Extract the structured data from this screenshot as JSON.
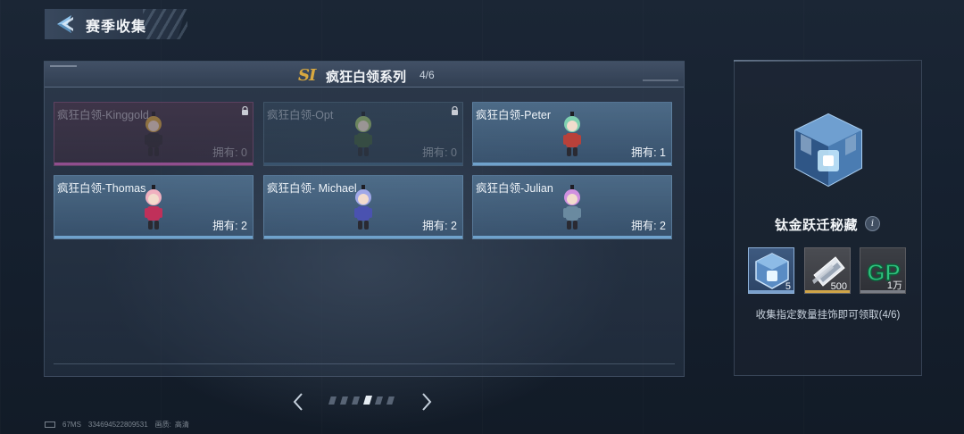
{
  "header": {
    "title": "赛季收集"
  },
  "series": {
    "badge": "SI",
    "name": "疯狂白领系列",
    "progress": "4/6"
  },
  "cards": [
    {
      "name": "疯狂白领-Kinggold",
      "owned": "拥有: 0",
      "state": "locked",
      "outfit": "#2b2b35",
      "accent": "#d4a640"
    },
    {
      "name": "疯狂白领-Opt",
      "owned": "拥有: 0",
      "state": "locked",
      "outfit": "#3e5a3a",
      "accent": "#9fbf6a"
    },
    {
      "name": "疯狂白领-Peter",
      "owned": "拥有: 1",
      "state": "owned",
      "outfit": "#b8413a",
      "accent": "#7fd0b0"
    },
    {
      "name": "疯狂白领-Thomas",
      "owned": "拥有: 2",
      "state": "owned",
      "outfit": "#c0305a",
      "accent": "#f0b0c0"
    },
    {
      "name": "疯狂白领- Michael",
      "owned": "拥有: 2",
      "state": "owned",
      "outfit": "#4a52b0",
      "accent": "#a0a8e8"
    },
    {
      "name": "疯狂白领-Julian",
      "owned": "拥有: 2",
      "state": "owned",
      "outfit": "#6a8aa0",
      "accent": "#d090e0"
    }
  ],
  "pager": {
    "total": 6,
    "active": 4
  },
  "reward": {
    "name": "钛金跃迁秘藏",
    "info": "i",
    "items": [
      {
        "icon": "titanium-crate-icon",
        "qty": "5"
      },
      {
        "icon": "ticket-icon",
        "qty": "500"
      },
      {
        "icon": "gp-currency-icon",
        "qty": "1万",
        "label": "GP"
      }
    ],
    "desc": "收集指定数量挂饰即可领取(4/6)"
  },
  "footer": {
    "ping": "67MS",
    "uid": "334694522809531",
    "quality_label": "画质:",
    "quality": "高清"
  },
  "colors": {
    "accent_blue": "#6fa2cc",
    "gold": "#d8a840",
    "pink": "#b05aa8"
  }
}
